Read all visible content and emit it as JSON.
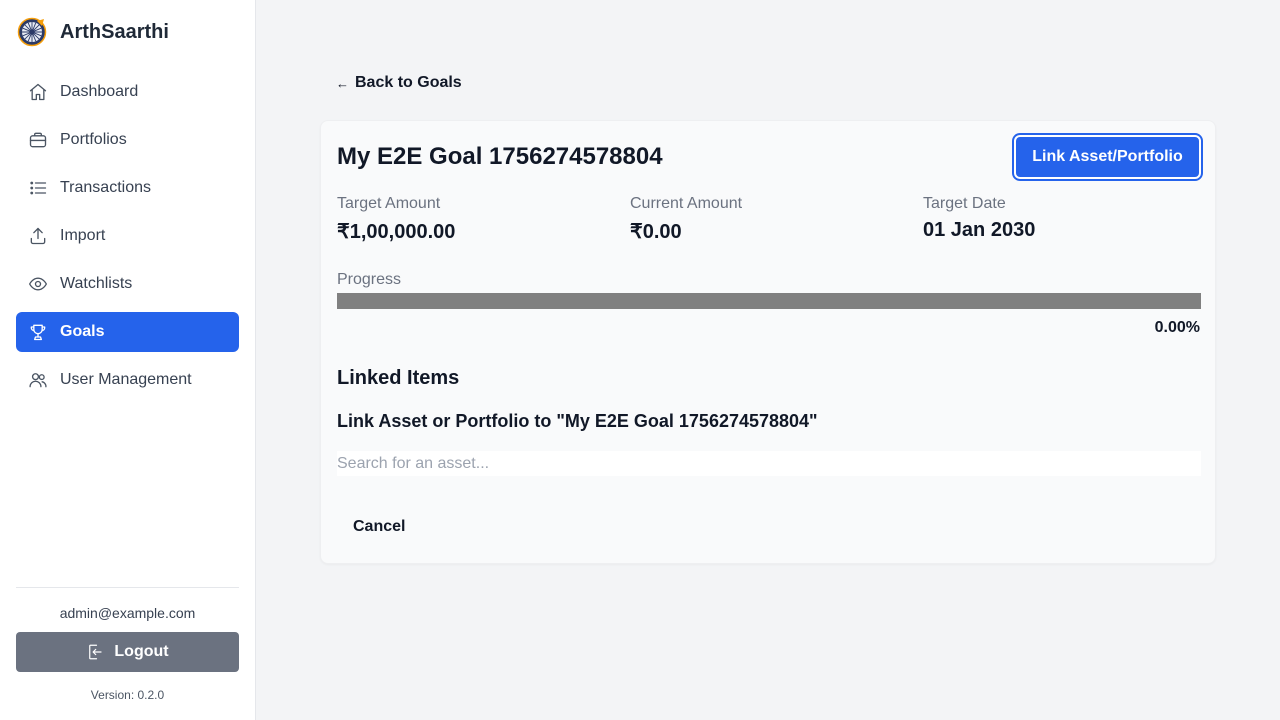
{
  "app": {
    "name": "ArthSaarthi",
    "logo_icon": "chakra-logo-icon"
  },
  "sidebar": {
    "items": [
      {
        "label": "Dashboard",
        "icon": "home-icon",
        "active": false
      },
      {
        "label": "Portfolios",
        "icon": "briefcase-icon",
        "active": false
      },
      {
        "label": "Transactions",
        "icon": "list-icon",
        "active": false
      },
      {
        "label": "Import",
        "icon": "upload-icon",
        "active": false
      },
      {
        "label": "Watchlists",
        "icon": "eye-icon",
        "active": false
      },
      {
        "label": "Goals",
        "icon": "trophy-icon",
        "active": true
      },
      {
        "label": "User Management",
        "icon": "users-icon",
        "active": false
      }
    ],
    "user_email": "admin@example.com",
    "logout_label": "Logout",
    "version": "Version: 0.2.0"
  },
  "main": {
    "back_label": "Back to Goals",
    "back_arrow": "←",
    "goal": {
      "title": "My E2E Goal 1756274578804",
      "link_button_label": "Link Asset/Portfolio",
      "stats": [
        {
          "label": "Target Amount",
          "value": "₹1,00,000.00"
        },
        {
          "label": "Current Amount",
          "value": "₹0.00"
        },
        {
          "label": "Target Date",
          "value": "01 Jan 2030"
        }
      ],
      "progress_label": "Progress",
      "progress_value": 0,
      "progress_text": "0.00%"
    },
    "linked_items_heading": "Linked Items",
    "link_form": {
      "heading": "Link Asset or Portfolio to \"My E2E Goal 1756274578804\"",
      "search_placeholder": "Search for an asset...",
      "search_value": "",
      "cancel_label": "Cancel"
    }
  },
  "colors": {
    "accent": "#2563eb",
    "logout_bg": "#6b7280",
    "progress_track": "#808080",
    "page_bg": "#f3f4f6"
  }
}
